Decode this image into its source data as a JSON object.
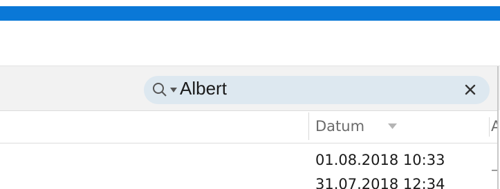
{
  "search": {
    "value": "Albert",
    "clear_label": "×"
  },
  "table": {
    "columns": [
      "Datum",
      "A"
    ],
    "rows": [
      {
        "datum": "01.08.2018 10:33"
      },
      {
        "datum": "31.07.2018 12:34"
      }
    ]
  },
  "colors": {
    "accent": "#0a78d7",
    "search_bg": "#dde8f0"
  },
  "icons": {
    "search": "magnifier-icon",
    "dropdown": "chevron-down-icon",
    "clear": "close-icon",
    "sort": "sort-descending-icon"
  }
}
